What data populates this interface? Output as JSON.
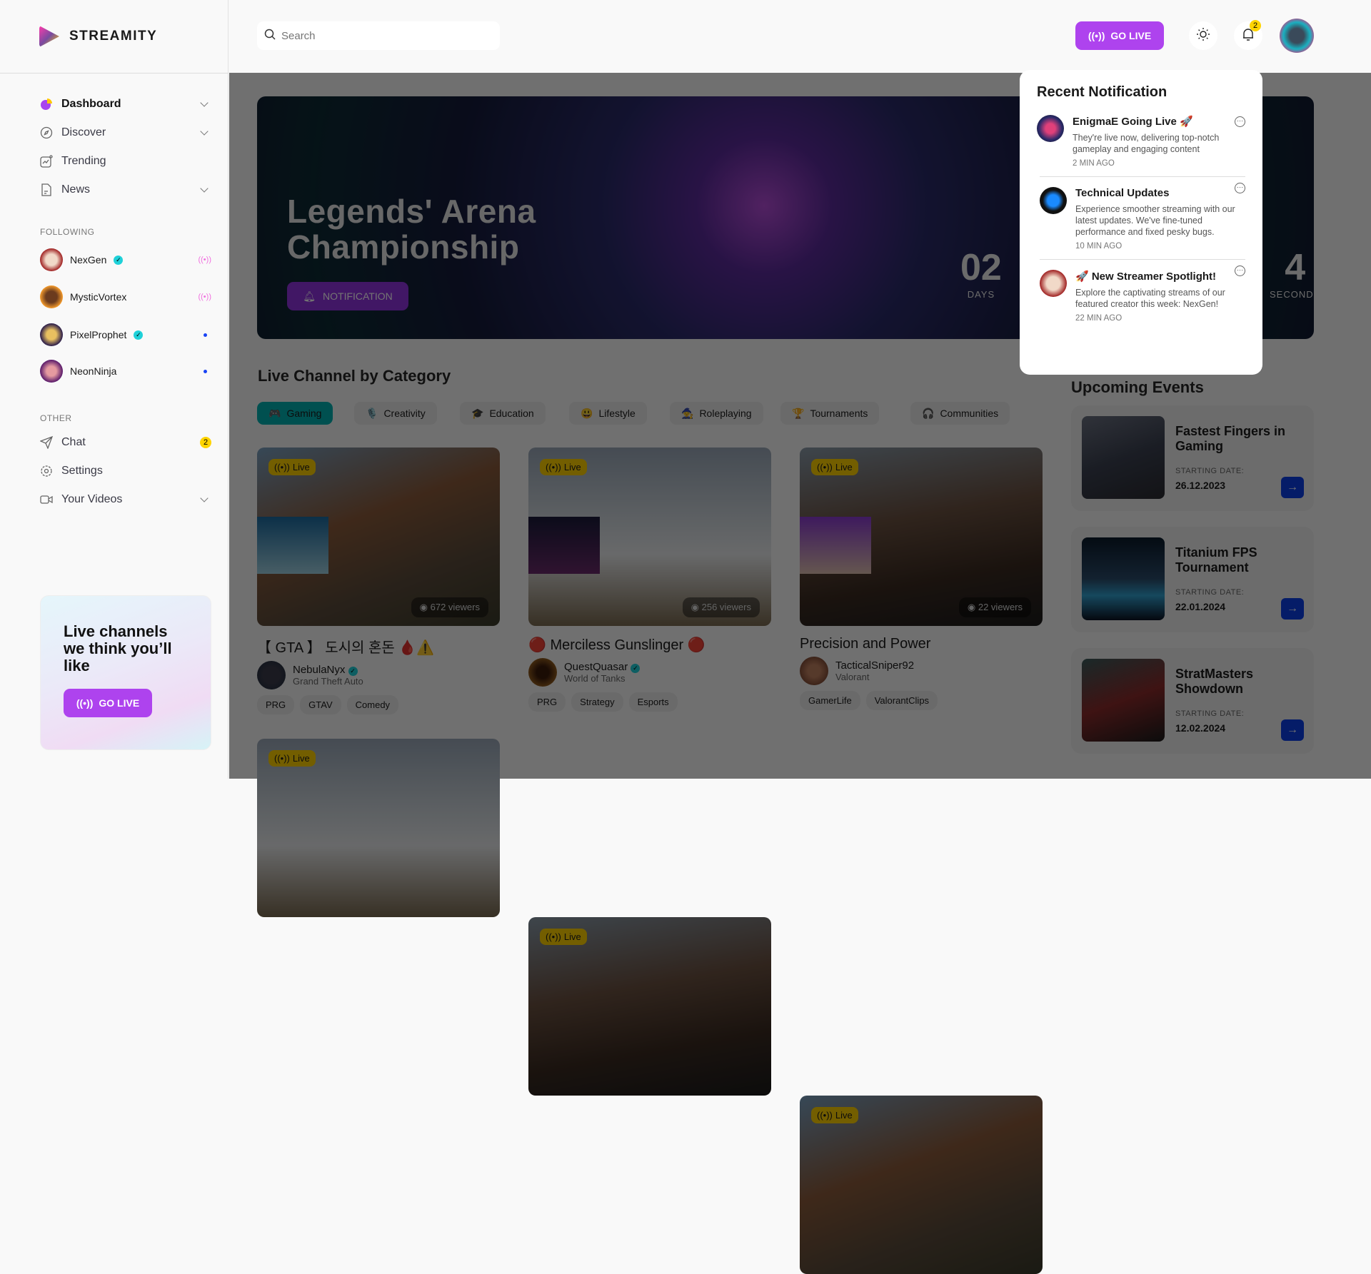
{
  "brand": {
    "name": "STREAMITY"
  },
  "colors": {
    "accent": "#ae43ee",
    "live": "#ffd100",
    "active_category": "#00b2b2",
    "event_button": "#0b3ee6",
    "notif_badge": "#ffd400"
  },
  "sidebar": {
    "nav": [
      {
        "label": "Dashboard",
        "icon": "dashboard-pie-icon",
        "expandable": true,
        "active": true
      },
      {
        "label": "Discover",
        "icon": "compass-icon",
        "expandable": true
      },
      {
        "label": "Trending",
        "icon": "trending-chart-icon",
        "expandable": false
      },
      {
        "label": "News",
        "icon": "document-icon",
        "expandable": true
      }
    ],
    "following_label": "FOLLOWING",
    "following": [
      {
        "name": "NexGen",
        "verified": true,
        "status": "live"
      },
      {
        "name": "MysticVortex",
        "verified": false,
        "status": "live"
      },
      {
        "name": "PixelProphet",
        "verified": true,
        "status": "online"
      },
      {
        "name": "NeonNinja",
        "verified": false,
        "status": "online"
      }
    ],
    "other_label": "OTHER",
    "other": [
      {
        "label": "Chat",
        "icon": "send-icon",
        "badge": "2"
      },
      {
        "label": "Settings",
        "icon": "gear-icon"
      },
      {
        "label": "Your Videos",
        "icon": "video-camera-icon",
        "expandable": true
      }
    ],
    "promo": {
      "title": "Live channels we think you’ll like",
      "button": "GO LIVE"
    }
  },
  "header": {
    "search_placeholder": "Search",
    "go_live": "GO LIVE",
    "notifications_count": "2"
  },
  "hero": {
    "title_line1": "Legends' Arena",
    "title_line2": "Championship",
    "button": "NOTIFICATION",
    "countdown": [
      {
        "value": "02",
        "label": "DAYS"
      },
      {
        "value": "4",
        "label": "SECONDS"
      }
    ]
  },
  "categories": {
    "title": "Live Channel by Category",
    "items": [
      {
        "label": "Gaming",
        "icon": "🎮",
        "active": true
      },
      {
        "label": "Creativity",
        "icon": "🎙️"
      },
      {
        "label": "Education",
        "icon": "🎓"
      },
      {
        "label": "Lifestyle",
        "icon": "😃"
      },
      {
        "label": "Roleplaying",
        "icon": "🧙"
      },
      {
        "label": "Tournaments",
        "icon": "🏆"
      },
      {
        "label": "Communities",
        "icon": "🎧"
      }
    ]
  },
  "streams": [
    {
      "live": "Live",
      "viewers": "672 viewers",
      "title": "【 GTA 】 도시의 혼돈 🩸⚠️",
      "streamer": "NebulaNyx",
      "verified": true,
      "game": "Grand Theft Auto",
      "tags": [
        "PRG",
        "GTAV",
        "Comedy"
      ]
    },
    {
      "live": "Live",
      "viewers": "256 viewers",
      "title": "🔴 Merciless Gunslinger 🔴",
      "streamer": "QuestQuasar",
      "verified": true,
      "game": "World of Tanks",
      "tags": [
        "PRG",
        "Strategy",
        "Esports"
      ]
    },
    {
      "live": "Live",
      "viewers": "22 viewers",
      "title": "Precision and Power",
      "streamer": "TacticalSniper92",
      "verified": false,
      "game": "Valorant",
      "tags": [
        "GamerLife",
        "ValorantClips"
      ]
    }
  ],
  "streams_row2": [
    {
      "live": "Live"
    },
    {
      "live": "Live"
    },
    {
      "live": "Live"
    }
  ],
  "events": {
    "title": "Upcoming Events",
    "date_label": "STARTING DATE:",
    "items": [
      {
        "title": "Fastest Fingers in Gaming",
        "date": "26.12.2023"
      },
      {
        "title": "Titanium FPS Tournament",
        "date": "22.01.2024"
      },
      {
        "title": "StratMasters Showdown",
        "date": "12.02.2024"
      }
    ]
  },
  "notifications": {
    "title": "Recent Notification",
    "items": [
      {
        "title": "EnigmaE Going Live 🚀",
        "body": "They're live now, delivering top-notch gameplay and engaging content",
        "time": "2 MIN AGO"
      },
      {
        "title": "Technical Updates",
        "body": "Experience smoother streaming with our latest updates. We've fine-tuned performance and fixed pesky bugs.",
        "time": "10 MIN AGO"
      },
      {
        "title": "🚀 New Streamer Spotlight!",
        "body": "Explore the captivating streams of our featured creator this week: NexGen!",
        "time": "22 MIN AGO"
      }
    ]
  }
}
